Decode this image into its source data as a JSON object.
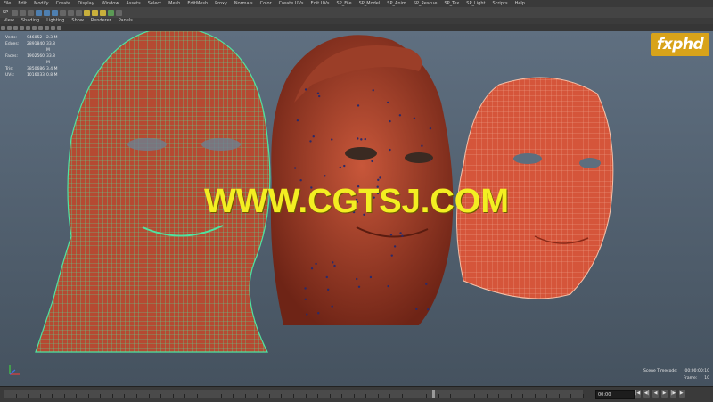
{
  "menubar": {
    "items": [
      "File",
      "Edit",
      "Modify",
      "Create",
      "Display",
      "Window",
      "Assets",
      "Select",
      "Mesh",
      "EditMesh",
      "Proxy",
      "Normals",
      "Color",
      "Create UVs",
      "Edit UVs",
      "SP_File",
      "SP_Model",
      "SP_Anim",
      "SP_Rescue",
      "SP_Tex",
      "SP_Light",
      "Scripts",
      "Help"
    ]
  },
  "shelf": {
    "selector": "SP"
  },
  "view_menu": {
    "items": [
      "View",
      "Shading",
      "Lighting",
      "Show",
      "Renderer",
      "Panels"
    ]
  },
  "hud_stats": {
    "rows": [
      {
        "label": "Verts:",
        "a": "946052",
        "b": "2.3 M"
      },
      {
        "label": "Edges:",
        "a": "2891840",
        "b": "33.8 M"
      },
      {
        "label": "Faces:",
        "a": "1902560",
        "b": "33.8 M"
      },
      {
        "label": "Tris:",
        "a": "3850686",
        "b": "3.4 M"
      },
      {
        "label": "UVs:",
        "a": "1016033",
        "b": "0.8 M"
      }
    ]
  },
  "logo": {
    "text": "fxphd",
    "color": "#d8a31a"
  },
  "watermark": {
    "text": "WWW.CGTSJ.COM",
    "color": "#f3ee22"
  },
  "hud_bottom_right": {
    "rows": [
      {
        "label": "Scene Timecode:",
        "value": "00:00:00:10"
      },
      {
        "label": "Frame:",
        "value": "10"
      }
    ]
  },
  "timeline": {
    "current_time": "00:00",
    "playback_buttons": [
      "|◀",
      "◀|",
      "◀",
      "▶",
      "|▶",
      "▶|"
    ],
    "cursor_fraction": 0.74
  },
  "viewport": {
    "background_top": "#5f6f80",
    "background_bottom": "#45525f",
    "wireframe_color": "#4fe3a0",
    "skin_color": "#b84a30",
    "mesh_color": "#e25a3c"
  }
}
